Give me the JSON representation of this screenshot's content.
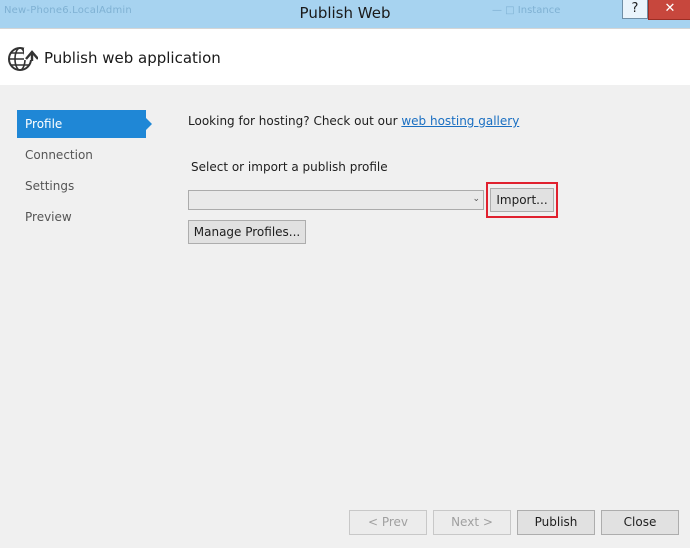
{
  "window": {
    "title": "Publish Web",
    "help_glyph": "?",
    "close_glyph": "✕",
    "blurred_left": "New-Phone6.LocalAdmin",
    "blurred_right": "— □  Instance"
  },
  "header": {
    "icon": "globe-publish-icon",
    "title": "Publish web application"
  },
  "nav": {
    "items": [
      {
        "label": "Profile",
        "active": true
      },
      {
        "label": "Connection",
        "active": false
      },
      {
        "label": "Settings",
        "active": false
      },
      {
        "label": "Preview",
        "active": false
      }
    ]
  },
  "main": {
    "hosting_prefix": "Looking for hosting? Check out our ",
    "hosting_link": "web hosting gallery",
    "select_label": "Select or import a publish profile",
    "profile_combo_value": "",
    "import_button": "Import...",
    "manage_button": "Manage Profiles..."
  },
  "footer": {
    "prev_button": "< Prev",
    "next_button": "Next >",
    "publish_button": "Publish",
    "close_button": "Close"
  },
  "colors": {
    "titlebar": "#a7d3f0",
    "nav_active": "#1f87d6",
    "highlight": "#e0212f",
    "close_button": "#c7473d"
  }
}
